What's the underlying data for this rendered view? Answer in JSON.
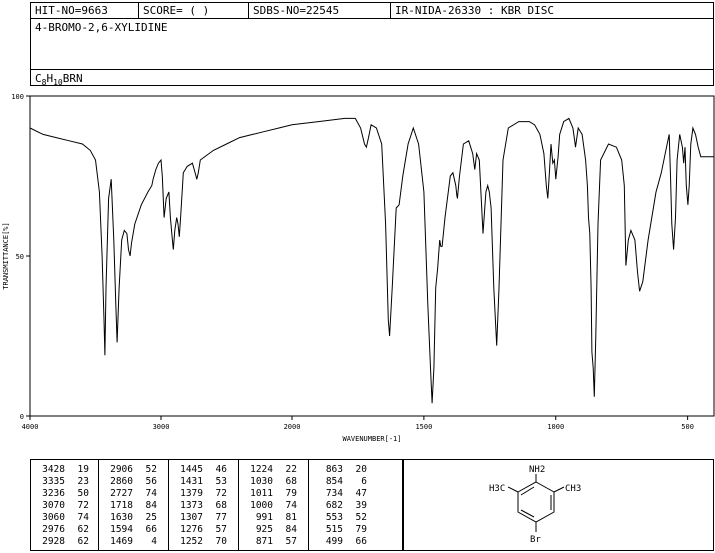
{
  "header": {
    "hit_no": "HIT-NO=9663",
    "score": "SCORE=  (  )",
    "sdbs_no": "SDBS-NO=22545",
    "ir_code": "IR-NIDA-26330 : KBR DISC"
  },
  "compound": {
    "name": "4-BROMO-2,6-XYLIDINE",
    "formula_parts": [
      "C",
      "8",
      "H",
      "10",
      "BRN"
    ]
  },
  "structure": {
    "nh2": "NH2",
    "left_methyl": "H3C",
    "right_methyl": "CH3",
    "bromo": "Br"
  },
  "chart_data": {
    "type": "line",
    "xlabel": "WAVENUMBER[-1]",
    "ylabel": "TRANSMITTANCE[%]",
    "xlim": [
      4000,
      400
    ],
    "ylim": [
      0,
      100
    ],
    "x_ticks": [
      4000,
      3000,
      2000,
      1500,
      1000,
      500
    ],
    "y_ticks": [
      0,
      50,
      100
    ],
    "series": [
      {
        "points": [
          [
            4000,
            90
          ],
          [
            3900,
            88
          ],
          [
            3800,
            87
          ],
          [
            3700,
            86
          ],
          [
            3600,
            85
          ],
          [
            3540,
            83
          ],
          [
            3500,
            80
          ],
          [
            3470,
            70
          ],
          [
            3450,
            50
          ],
          [
            3435,
            30
          ],
          [
            3428,
            19
          ],
          [
            3420,
            40
          ],
          [
            3400,
            68
          ],
          [
            3380,
            74
          ],
          [
            3360,
            55
          ],
          [
            3345,
            35
          ],
          [
            3335,
            23
          ],
          [
            3320,
            40
          ],
          [
            3300,
            55
          ],
          [
            3280,
            58
          ],
          [
            3260,
            57
          ],
          [
            3248,
            52
          ],
          [
            3236,
            50
          ],
          [
            3225,
            54
          ],
          [
            3200,
            60
          ],
          [
            3150,
            66
          ],
          [
            3100,
            70
          ],
          [
            3070,
            72
          ],
          [
            3060,
            74
          ],
          [
            3040,
            77
          ],
          [
            3020,
            79
          ],
          [
            3000,
            80
          ],
          [
            2990,
            75
          ],
          [
            2976,
            62
          ],
          [
            2960,
            68
          ],
          [
            2940,
            70
          ],
          [
            2928,
            62
          ],
          [
            2915,
            56
          ],
          [
            2906,
            52
          ],
          [
            2895,
            58
          ],
          [
            2880,
            62
          ],
          [
            2870,
            60
          ],
          [
            2860,
            56
          ],
          [
            2850,
            62
          ],
          [
            2830,
            76
          ],
          [
            2800,
            78
          ],
          [
            2760,
            79
          ],
          [
            2740,
            76
          ],
          [
            2727,
            74
          ],
          [
            2715,
            76
          ],
          [
            2700,
            80
          ],
          [
            2600,
            83
          ],
          [
            2500,
            85
          ],
          [
            2400,
            87
          ],
          [
            2300,
            88
          ],
          [
            2200,
            89
          ],
          [
            2100,
            90
          ],
          [
            2000,
            91
          ],
          [
            1900,
            92
          ],
          [
            1800,
            93
          ],
          [
            1760,
            93
          ],
          [
            1740,
            90
          ],
          [
            1725,
            85
          ],
          [
            1718,
            84
          ],
          [
            1710,
            87
          ],
          [
            1700,
            91
          ],
          [
            1680,
            90
          ],
          [
            1660,
            85
          ],
          [
            1645,
            60
          ],
          [
            1635,
            30
          ],
          [
            1630,
            25
          ],
          [
            1620,
            40
          ],
          [
            1605,
            65
          ],
          [
            1594,
            66
          ],
          [
            1580,
            75
          ],
          [
            1560,
            85
          ],
          [
            1540,
            90
          ],
          [
            1520,
            85
          ],
          [
            1500,
            70
          ],
          [
            1485,
            35
          ],
          [
            1475,
            15
          ],
          [
            1469,
            4
          ],
          [
            1462,
            15
          ],
          [
            1455,
            40
          ],
          [
            1448,
            46
          ],
          [
            1440,
            55
          ],
          [
            1436,
            53
          ],
          [
            1431,
            53
          ],
          [
            1420,
            62
          ],
          [
            1400,
            75
          ],
          [
            1390,
            76
          ],
          [
            1379,
            72
          ],
          [
            1375,
            69
          ],
          [
            1373,
            68
          ],
          [
            1365,
            75
          ],
          [
            1350,
            85
          ],
          [
            1330,
            86
          ],
          [
            1315,
            82
          ],
          [
            1307,
            77
          ],
          [
            1300,
            82
          ],
          [
            1290,
            80
          ],
          [
            1276,
            57
          ],
          [
            1265,
            70
          ],
          [
            1258,
            72
          ],
          [
            1252,
            70
          ],
          [
            1245,
            65
          ],
          [
            1235,
            40
          ],
          [
            1224,
            22
          ],
          [
            1215,
            40
          ],
          [
            1200,
            80
          ],
          [
            1180,
            90
          ],
          [
            1140,
            92
          ],
          [
            1100,
            92
          ],
          [
            1080,
            91
          ],
          [
            1060,
            88
          ],
          [
            1045,
            82
          ],
          [
            1036,
            72
          ],
          [
            1030,
            68
          ],
          [
            1025,
            75
          ],
          [
            1018,
            85
          ],
          [
            1011,
            79
          ],
          [
            1005,
            80
          ],
          [
            1000,
            74
          ],
          [
            995,
            78
          ],
          [
            991,
            81
          ],
          [
            985,
            88
          ],
          [
            970,
            92
          ],
          [
            950,
            93
          ],
          [
            935,
            90
          ],
          [
            928,
            86
          ],
          [
            925,
            84
          ],
          [
            915,
            90
          ],
          [
            900,
            88
          ],
          [
            887,
            80
          ],
          [
            880,
            72
          ],
          [
            876,
            62
          ],
          [
            871,
            57
          ],
          [
            866,
            40
          ],
          [
            863,
            20
          ],
          [
            858,
            15
          ],
          [
            854,
            6
          ],
          [
            848,
            25
          ],
          [
            840,
            60
          ],
          [
            830,
            80
          ],
          [
            800,
            85
          ],
          [
            770,
            84
          ],
          [
            750,
            80
          ],
          [
            740,
            72
          ],
          [
            734,
            47
          ],
          [
            725,
            55
          ],
          [
            715,
            58
          ],
          [
            700,
            55
          ],
          [
            690,
            45
          ],
          [
            682,
            39
          ],
          [
            670,
            42
          ],
          [
            650,
            55
          ],
          [
            620,
            70
          ],
          [
            600,
            76
          ],
          [
            580,
            84
          ],
          [
            570,
            88
          ],
          [
            565,
            75
          ],
          [
            560,
            60
          ],
          [
            553,
            52
          ],
          [
            546,
            62
          ],
          [
            540,
            80
          ],
          [
            530,
            88
          ],
          [
            520,
            84
          ],
          [
            515,
            79
          ],
          [
            510,
            84
          ],
          [
            505,
            72
          ],
          [
            499,
            66
          ],
          [
            494,
            72
          ],
          [
            488,
            85
          ],
          [
            480,
            90
          ],
          [
            470,
            88
          ],
          [
            460,
            84
          ],
          [
            450,
            81
          ],
          [
            430,
            81
          ],
          [
            400,
            81
          ]
        ]
      }
    ]
  },
  "peak_table": {
    "columns": [
      [
        [
          "3428",
          "19"
        ],
        [
          "3335",
          "23"
        ],
        [
          "3236",
          "50"
        ],
        [
          "3070",
          "72"
        ],
        [
          "3060",
          "74"
        ],
        [
          "2976",
          "62"
        ],
        [
          "2928",
          "62"
        ]
      ],
      [
        [
          "2906",
          "52"
        ],
        [
          "2860",
          "56"
        ],
        [
          "2727",
          "74"
        ],
        [
          "1718",
          "84"
        ],
        [
          "1630",
          "25"
        ],
        [
          "1594",
          "66"
        ],
        [
          "1469",
          "4"
        ]
      ],
      [
        [
          "1445",
          "46"
        ],
        [
          "1431",
          "53"
        ],
        [
          "1379",
          "72"
        ],
        [
          "1373",
          "68"
        ],
        [
          "1307",
          "77"
        ],
        [
          "1276",
          "57"
        ],
        [
          "1252",
          "70"
        ]
      ],
      [
        [
          "1224",
          "22"
        ],
        [
          "1030",
          "68"
        ],
        [
          "1011",
          "79"
        ],
        [
          "1000",
          "74"
        ],
        [
          "991",
          "81"
        ],
        [
          "925",
          "84"
        ],
        [
          "871",
          "57"
        ]
      ],
      [
        [
          "863",
          "20"
        ],
        [
          "854",
          "6"
        ],
        [
          "734",
          "47"
        ],
        [
          "682",
          "39"
        ],
        [
          "553",
          "52"
        ],
        [
          "515",
          "79"
        ],
        [
          "499",
          "66"
        ]
      ]
    ]
  }
}
